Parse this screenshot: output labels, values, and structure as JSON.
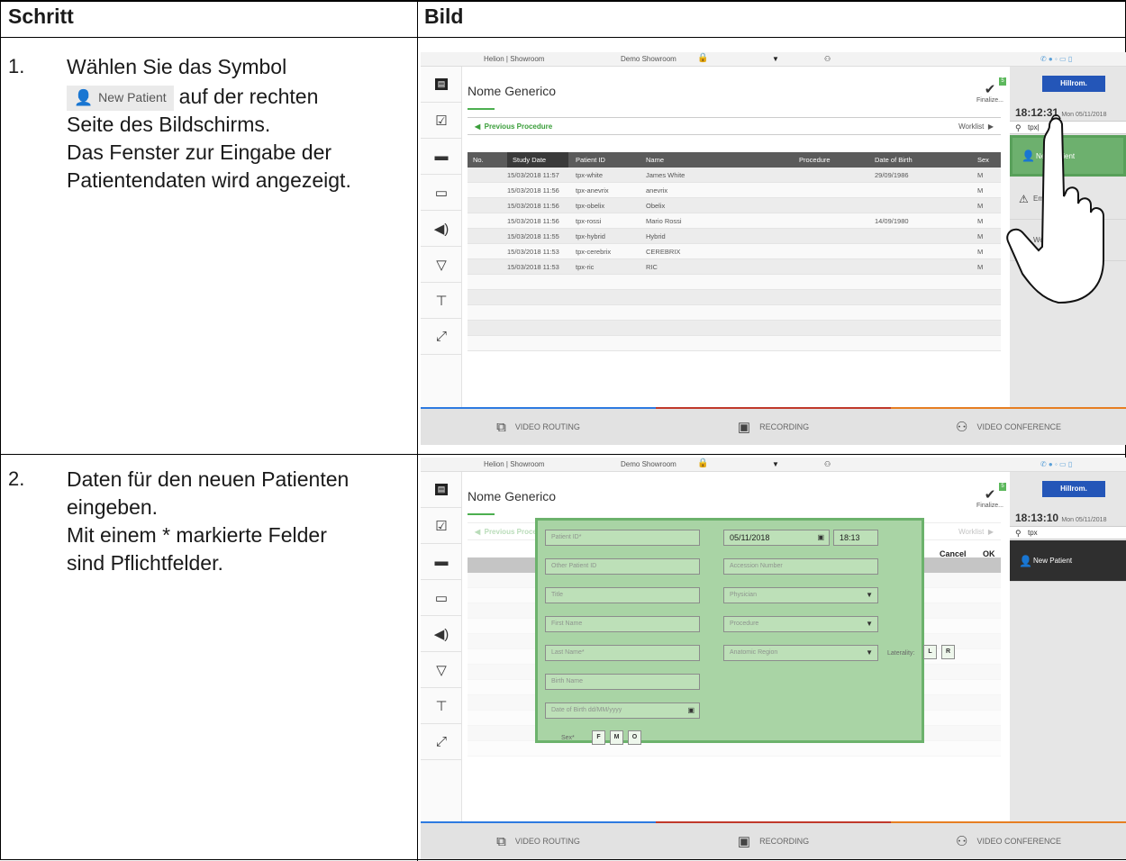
{
  "table": {
    "col_step": "Schritt",
    "col_image": "Bild"
  },
  "steps": [
    {
      "num": "1.",
      "line1": "Wählen Sie das Symbol",
      "inline_button": "New Patient",
      "line2": "auf der rechten",
      "line3": "Seite des Bildschirms.",
      "line4": "Das Fenster zur Eingabe der",
      "line5": "Patientendaten wird angezeigt."
    },
    {
      "num": "2.",
      "line1": "Daten für den neuen Patienten",
      "line2": "eingeben.",
      "line3": "Mit einem * markierte Felder",
      "line4": "sind Pflichtfelder."
    }
  ],
  "ui": {
    "topbar": {
      "left": "Helion | Showroom",
      "center": "Demo Showroom"
    },
    "patient_name": "Nome Generico",
    "finalize": "Finalize...",
    "finalize_badge": "5",
    "logo": "Hillrom.",
    "clock1": {
      "time": "18:12:31",
      "date": "Mon 05/11/2018"
    },
    "clock2": {
      "time": "18:13:10",
      "date": "Mon 05/11/2018"
    },
    "search1": "tpx|",
    "search2": "tpx",
    "new_patient": "New Patient",
    "emergency": "Emergency N",
    "worklist_btn": "Workl",
    "prev_procedure": "Previous Procedure",
    "worklist": "Worklist",
    "bottom": {
      "routing": "VIDEO ROUTING",
      "recording": "RECORDING",
      "conference": "VIDEO CONFERENCE"
    },
    "columns": [
      "No.",
      "Study Date",
      "Patient ID",
      "Name",
      "Procedure",
      "Date of Birth",
      "Sex"
    ],
    "rows": [
      {
        "date": "15/03/2018 11:57",
        "id": "tpx-white",
        "name": "James White",
        "dob": "29/09/1986",
        "sex": "M"
      },
      {
        "date": "15/03/2018 11:56",
        "id": "tpx-anevrix",
        "name": "anevrix",
        "dob": "",
        "sex": "M"
      },
      {
        "date": "15/03/2018 11:56",
        "id": "tpx-obelix",
        "name": "Obelix",
        "dob": "",
        "sex": "M"
      },
      {
        "date": "15/03/2018 11:56",
        "id": "tpx-rossi",
        "name": "Mario Rossi",
        "dob": "14/09/1980",
        "sex": "M"
      },
      {
        "date": "15/03/2018 11:55",
        "id": "tpx-hybrid",
        "name": "Hybrid",
        "dob": "",
        "sex": "M"
      },
      {
        "date": "15/03/2018 11:53",
        "id": "tpx-cerebrix",
        "name": "CEREBRIX",
        "dob": "",
        "sex": "M"
      },
      {
        "date": "15/03/2018 11:53",
        "id": "tpx-ric",
        "name": "RIC",
        "dob": "",
        "sex": "M"
      }
    ],
    "form": {
      "patient_id": "Patient ID*",
      "other_patient_id": "Other Patient ID",
      "title": "Title",
      "first_name": "First Name",
      "last_name": "Last Name*",
      "birth_name": "Birth Name",
      "dob": "Date of Birth dd/MM/yyyy",
      "sex_label": "Sex*",
      "sex_f": "F",
      "sex_m": "M",
      "sex_o": "O",
      "date": "05/11/2018",
      "time": "18:13",
      "accession": "Accession Number",
      "physician": "Physician",
      "procedure": "Procedure",
      "anatomic": "Anatomic Region",
      "laterality": "Laterality:",
      "lat_l": "L",
      "lat_r": "R",
      "cancel": "Cancel",
      "ok": "OK"
    }
  }
}
